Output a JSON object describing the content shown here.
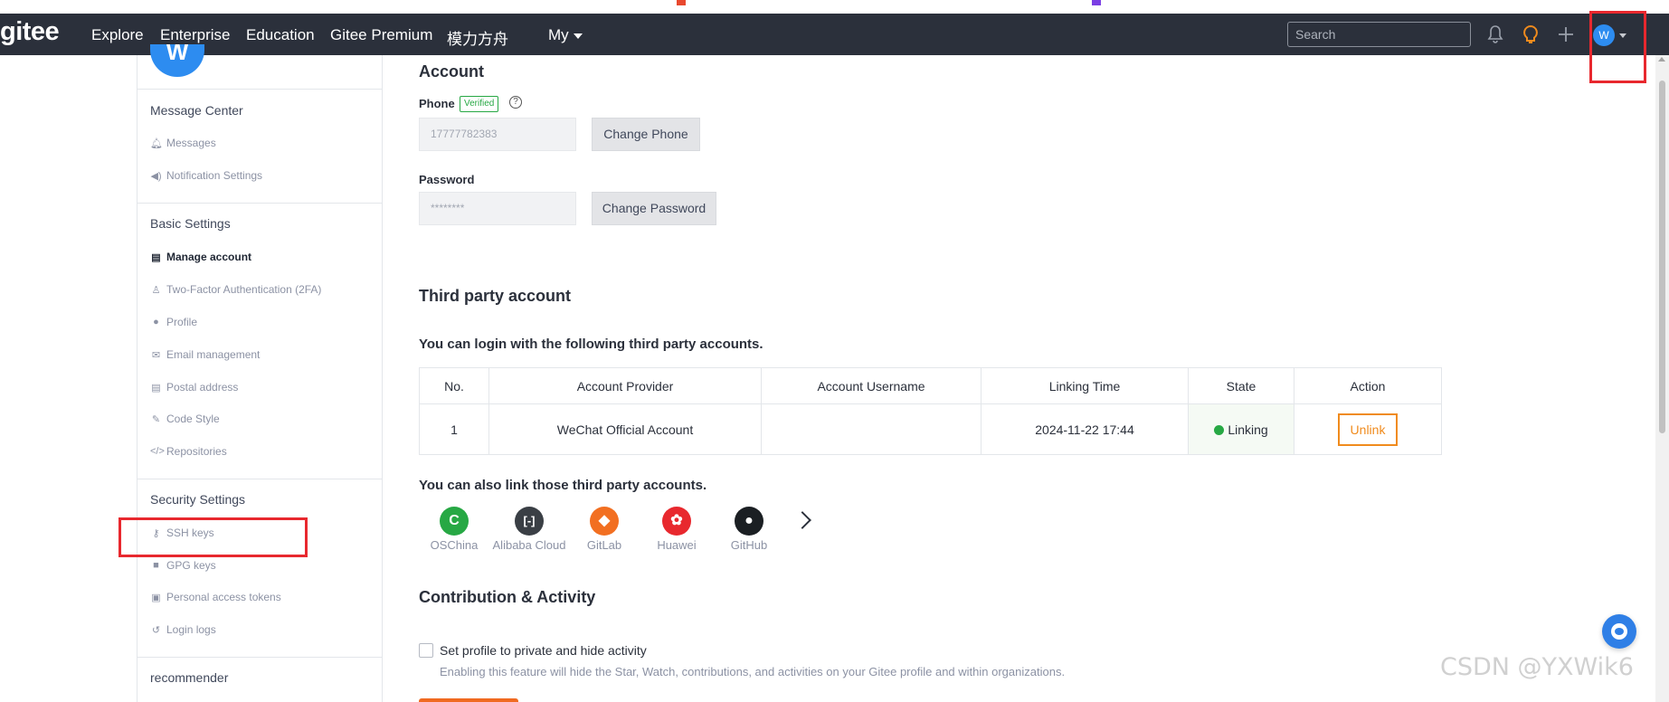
{
  "nav": {
    "logo": "gitee",
    "items": [
      "Explore",
      "Enterprise",
      "Education",
      "Gitee Premium",
      "模力方舟"
    ],
    "my": "My",
    "search_placeholder": "Search",
    "avatar_letter": "W"
  },
  "sidebar": {
    "avatar_letter": "W",
    "groups": [
      {
        "heading": "Message Center",
        "items": [
          {
            "label": "Messages",
            "icon": "bell-icon"
          },
          {
            "label": "Notification Settings",
            "icon": "speaker-icon"
          }
        ]
      },
      {
        "heading": "Basic Settings",
        "items": [
          {
            "label": "Manage account",
            "icon": "id-card-icon",
            "active": true
          },
          {
            "label": "Two-Factor Authentication (2FA)",
            "icon": "user-key-icon"
          },
          {
            "label": "Profile",
            "icon": "user-icon"
          },
          {
            "label": "Email management",
            "icon": "envelope-icon"
          },
          {
            "label": "Postal address",
            "icon": "address-card-icon"
          },
          {
            "label": "Code Style",
            "icon": "brush-icon"
          },
          {
            "label": "Repositories",
            "icon": "code-icon"
          }
        ]
      },
      {
        "heading": "Security Settings",
        "items": [
          {
            "label": "SSH keys",
            "icon": "key-icon"
          },
          {
            "label": "GPG keys",
            "icon": "lock-icon"
          },
          {
            "label": "Personal access tokens",
            "icon": "token-icon"
          },
          {
            "label": "Login logs",
            "icon": "history-icon"
          }
        ]
      },
      {
        "heading": "recommender",
        "items": []
      }
    ]
  },
  "account": {
    "title": "Account",
    "phone_label": "Phone",
    "verified": "Verified",
    "phone_value": "17777782383",
    "change_phone": "Change Phone",
    "password_label": "Password",
    "password_value": "********",
    "change_password": "Change Password"
  },
  "third_party": {
    "title": "Third party account",
    "login_info": "You can login with the following third party accounts.",
    "columns": [
      "No.",
      "Account Provider",
      "Account Username",
      "Linking Time",
      "State",
      "Action"
    ],
    "rows": [
      {
        "no": "1",
        "provider": "WeChat Official Account",
        "username": "",
        "time": "2024-11-22 17:44",
        "state": "Linking",
        "action": "Unlink"
      }
    ],
    "also_link": "You can also link those third party accounts.",
    "providers": [
      {
        "name": "OSChina",
        "color": "#27a844",
        "glyph": "C"
      },
      {
        "name": "Alibaba Cloud",
        "color": "#3a3f45",
        "glyph": "[-]"
      },
      {
        "name": "GitLab",
        "color": "#f26f21",
        "glyph": "◆"
      },
      {
        "name": "Huawei",
        "color": "#e8282e",
        "glyph": "✿"
      },
      {
        "name": "GitHub",
        "color": "#1b1f23",
        "glyph": "●"
      }
    ]
  },
  "contribution": {
    "title": "Contribution & Activity",
    "checkbox_label": "Set profile to private and hide activity",
    "checkbox_desc": "Enabling this feature will hide the Star, Watch, contributions, and activities on your Gitee profile and within organizations."
  },
  "watermark": "CSDN @YXWik6"
}
